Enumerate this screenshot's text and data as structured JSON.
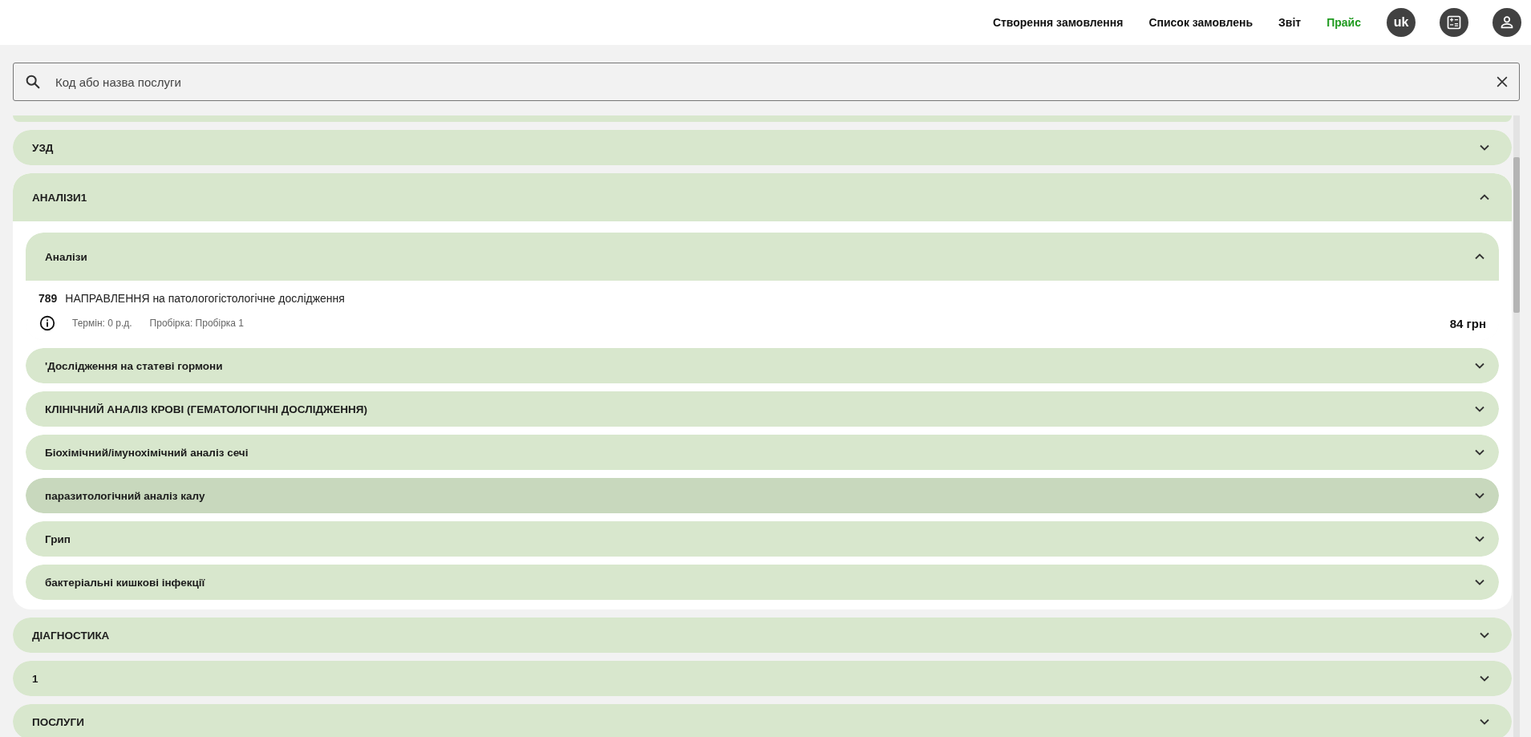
{
  "nav": {
    "links": [
      {
        "label": "Створення замовлення",
        "selected": false
      },
      {
        "label": "Список замовлень",
        "selected": false
      },
      {
        "label": "Звіт",
        "selected": false
      },
      {
        "label": "Прайс",
        "selected": true
      }
    ],
    "language": "uk"
  },
  "search": {
    "placeholder": "Код або назва послуги"
  },
  "categories": [
    {
      "title": "УЗД",
      "expanded": false
    },
    {
      "title": "АНАЛІЗИ1",
      "expanded": true,
      "groups": [
        {
          "title": "Аналізи",
          "expanded": true,
          "highlighted": false,
          "services": [
            {
              "code": "789",
              "name": "НАПРАВЛЕННЯ на патологогістологічне дослідження",
              "term": "Термін: 0 р.д.",
              "tube": "Пробірка: Пробірка 1",
              "price": "84 грн"
            }
          ]
        },
        {
          "title": "'Дослідження на статеві гормони",
          "expanded": false,
          "highlighted": false
        },
        {
          "title": "КЛІНІЧНИЙ АНАЛІЗ КРОВІ (ГЕМАТОЛОГІЧНІ ДОСЛІДЖЕННЯ)",
          "expanded": false,
          "highlighted": false
        },
        {
          "title": "Біохімічний/імунохімічний аналіз сечі",
          "expanded": false,
          "highlighted": false
        },
        {
          "title": "паразитологічний аналіз калу",
          "expanded": false,
          "highlighted": true
        },
        {
          "title": "Грип",
          "expanded": false,
          "highlighted": false
        },
        {
          "title": "бактеріальні кишкові інфекції",
          "expanded": false,
          "highlighted": false
        }
      ]
    },
    {
      "title": "ДІАГНОСТИКА",
      "expanded": false
    },
    {
      "title": "1",
      "expanded": false
    },
    {
      "title": "ПОСЛУГИ",
      "expanded": false
    }
  ]
}
